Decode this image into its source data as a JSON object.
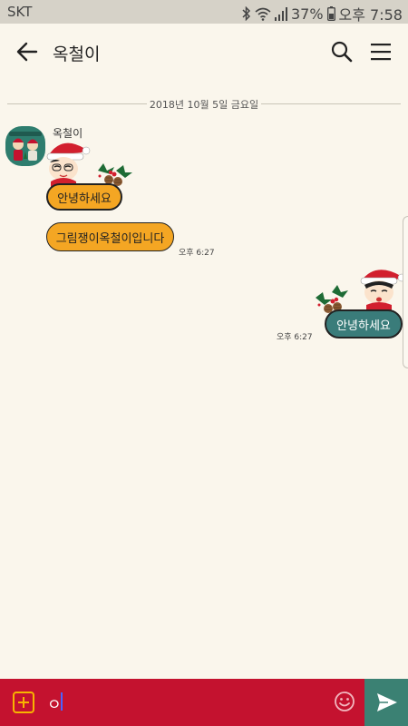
{
  "status_bar": {
    "carrier": "SKT",
    "battery": "37%",
    "time": "오후 7:58"
  },
  "header": {
    "title": "옥철이",
    "icons": {
      "back": "arrow-left-icon",
      "search": "search-icon",
      "menu": "hamburger-menu-icon"
    }
  },
  "chat": {
    "date_divider": "2018년 10월 5일 금요일",
    "messages": [
      {
        "direction": "incoming",
        "sender": "옥철이",
        "type": "sticker",
        "sticker_text": "안녕하세요"
      },
      {
        "direction": "incoming",
        "type": "text",
        "text": "그림쟁이옥철이입니다",
        "time": "오후 6:27"
      },
      {
        "direction": "outgoing",
        "type": "sticker",
        "sticker_text": "안녕하세요",
        "time": "오후 6:27"
      }
    ]
  },
  "input_bar": {
    "value": "ㅇ",
    "icons": {
      "add": "plus-square-icon",
      "emoji": "smiley-icon",
      "send": "send-icon"
    }
  },
  "colors": {
    "background": "#faf6ec",
    "status_bar": "#d6d2c8",
    "incoming_bubble": "#f4a623",
    "outgoing_bubble": "#3a7c7a",
    "input_bar": "#c4122f",
    "send_button": "#3b8173",
    "accent_yellow": "#f8b400"
  }
}
